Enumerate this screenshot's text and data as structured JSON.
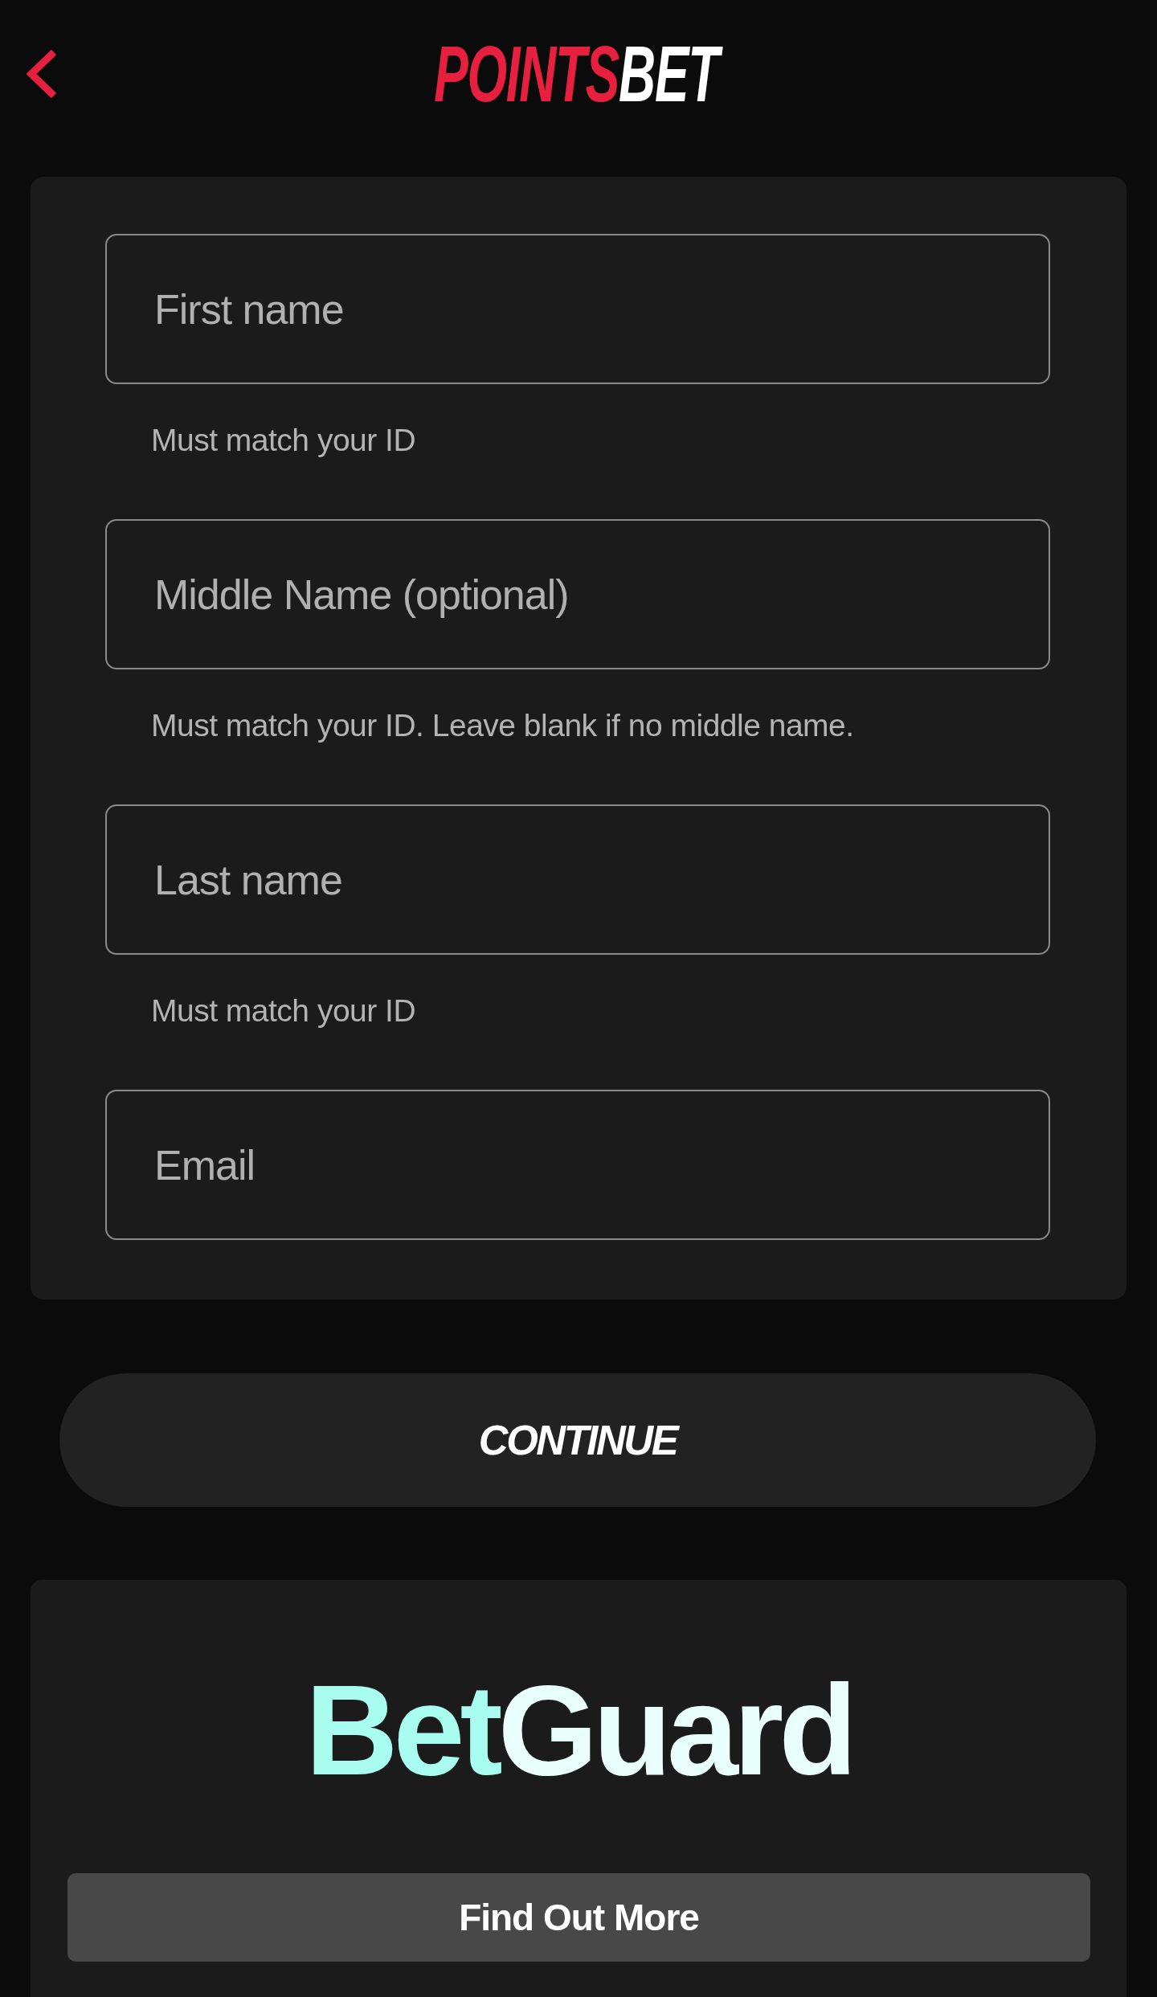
{
  "header": {
    "logo": {
      "parts": [
        {
          "text": "POINTS",
          "color": "#e8203f"
        },
        {
          "text": "BET",
          "color": "#ffffff"
        }
      ]
    }
  },
  "form": {
    "fields": [
      {
        "placeholder": "First name",
        "hint": "Must match your ID"
      },
      {
        "placeholder": "Middle Name (optional)",
        "hint": "Must match your ID. Leave blank if no middle name."
      },
      {
        "placeholder": "Last name",
        "hint": "Must match your ID"
      },
      {
        "placeholder": "Email"
      }
    ]
  },
  "continue_button": {
    "label": "CONTINUE"
  },
  "betguard": {
    "logo": {
      "parts": [
        {
          "text": "Bet",
          "color": "#a9fdf0"
        },
        {
          "text": "Guard",
          "color": "#e8fffb"
        }
      ]
    },
    "button": {
      "label": "Find Out More"
    }
  }
}
